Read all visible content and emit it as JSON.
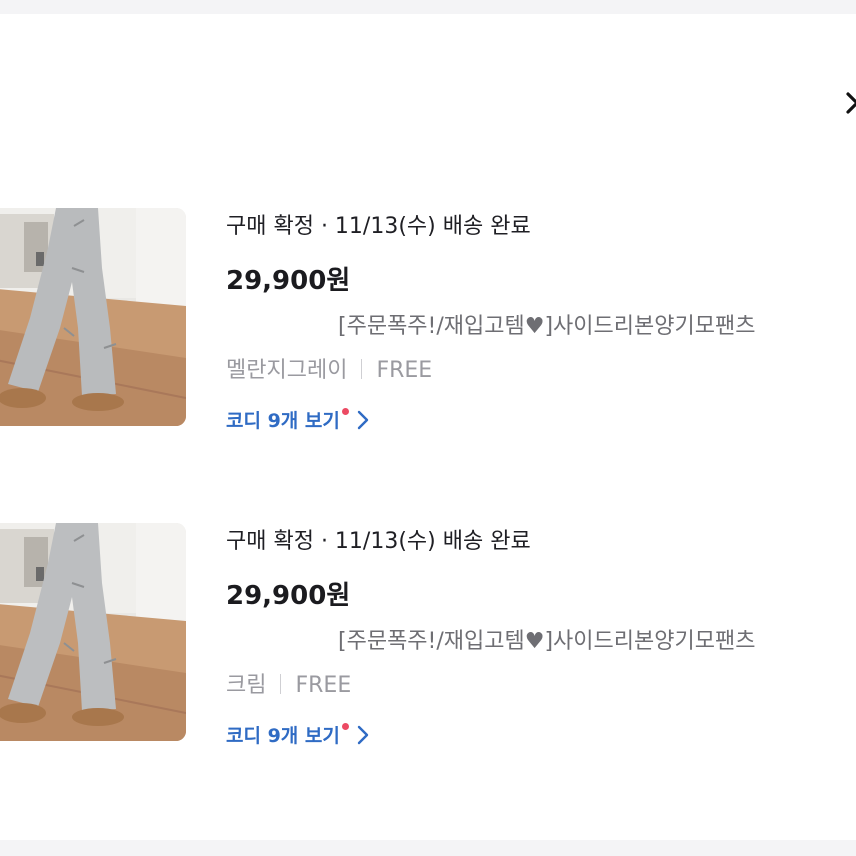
{
  "close_icon": "close-icon",
  "orders": [
    {
      "status": "구매 확정 · 11/13(수) 배송 완료",
      "price": "29,900원",
      "product_name": "[주문폭주!/재입고템♥]사이드리본양기모팬츠",
      "color": "멜란지그레이",
      "size": "FREE",
      "codi_label": "코디 9개 보기",
      "pants_color": "#b9bbbd"
    },
    {
      "status": "구매 확정 · 11/13(수) 배송 완료",
      "price": "29,900원",
      "product_name": "[주문폭주!/재입고템♥]사이드리본양기모팬츠",
      "color": "크림",
      "size": "FREE",
      "codi_label": "코디 9개 보기",
      "pants_color": "#bcbec0"
    }
  ],
  "colors": {
    "link": "#2f6bc4",
    "new_dot": "#ec4a63",
    "price": "#1b1b1f",
    "muted": "#9a9aa0"
  }
}
